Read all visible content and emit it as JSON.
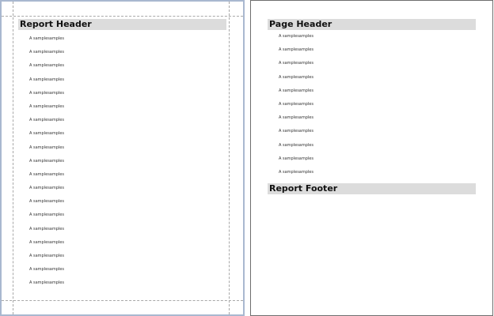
{
  "report": {
    "left_page": {
      "band_title": "Report Header",
      "sample_lines": [
        "A samplesamples",
        "A samplesamples",
        "A samplesamples",
        "A samplesamples",
        "A samplesamples",
        "A samplesamples",
        "A samplesamples",
        "A samplesamples",
        "A samplesamples",
        "A samplesamples",
        "A samplesamples",
        "A samplesamples",
        "A samplesamples",
        "A samplesamples",
        "A samplesamples",
        "A samplesamples",
        "A samplesamples",
        "A samplesamples",
        "A samplesamples"
      ]
    },
    "right_page": {
      "header_title": "Page Header",
      "sample_lines": [
        "A samplesamples",
        "A samplesamples",
        "A samplesamples",
        "A samplesamples",
        "A samplesamples",
        "A samplesamples",
        "A samplesamples",
        "A samplesamples",
        "A samplesamples",
        "A samplesamples",
        "A samplesamples"
      ],
      "footer_title": "Report Footer"
    }
  },
  "colors": {
    "band_background": "#dcdcdc",
    "selected_page_border": "#a9b8d0",
    "page_border": "#6e6e6e",
    "guide_lines": "#a8a8a8"
  }
}
